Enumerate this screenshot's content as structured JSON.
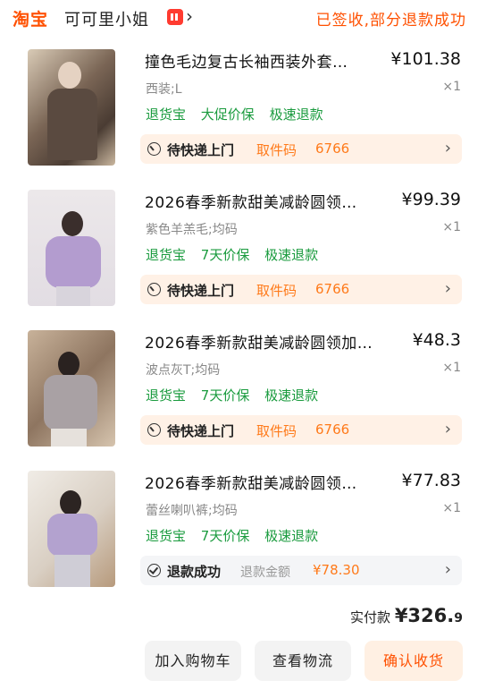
{
  "header": {
    "brand": "淘宝",
    "shop_name": "可可里小姐",
    "order_status": "已签收,部分退款成功"
  },
  "items": [
    {
      "title": "撞色毛边复古长袖西装外套…",
      "price": "¥101.38",
      "sku": "西装;L",
      "qty": "×1",
      "tags": [
        "退货宝",
        "大促价保",
        "极速退款"
      ],
      "status": {
        "icon": "truck-clock-icon",
        "label": "待快递上门",
        "pickup_label": "取件码",
        "pickup_code": "6766"
      }
    },
    {
      "title": "2026春季新款甜美减龄圆领…",
      "price": "¥99.39",
      "sku": "紫色羊羔毛;均码",
      "qty": "×1",
      "tags": [
        "退货宝",
        "7天价保",
        "极速退款"
      ],
      "status": {
        "icon": "truck-clock-icon",
        "label": "待快递上门",
        "pickup_label": "取件码",
        "pickup_code": "6766"
      }
    },
    {
      "title": "2026春季新款甜美减龄圆领加…",
      "price": "¥48.3",
      "sku": "波点灰T;均码",
      "qty": "×1",
      "tags": [
        "退货宝",
        "7天价保",
        "极速退款"
      ],
      "status": {
        "icon": "truck-clock-icon",
        "label": "待快递上门",
        "pickup_label": "取件码",
        "pickup_code": "6766"
      }
    },
    {
      "title": "2026春季新款甜美减龄圆领…",
      "price": "¥77.83",
      "sku": "蕾丝喇叭裤;均码",
      "qty": "×1",
      "tags": [
        "退货宝",
        "7天价保",
        "极速退款"
      ],
      "status": {
        "icon": "check-circle-icon",
        "label": "退款成功",
        "refund_label": "退款金额",
        "refund_amount": "¥78.30"
      }
    }
  ],
  "footer": {
    "total_label": "实付款",
    "total_amount": "¥326.",
    "total_small": "9",
    "buttons": [
      "加入购物车",
      "查看物流",
      "确认收货"
    ]
  },
  "colors": {
    "accent": "#ff5000",
    "tag_green": "#1a9b3e",
    "status_bg": "#fff1e6"
  }
}
